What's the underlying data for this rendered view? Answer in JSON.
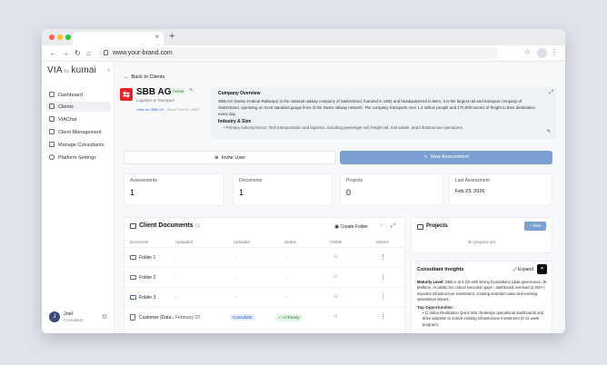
{
  "browser": {
    "url": "www.your-brand.com",
    "tab_close": "×",
    "new_tab": "+"
  },
  "sidebar": {
    "logo_left": "VIA",
    "logo_small": "by",
    "logo_right": "kumai",
    "collapse_icon": "‹",
    "items": [
      {
        "label": "Dashboard"
      },
      {
        "label": "Clients"
      },
      {
        "label": "VIAChat"
      },
      {
        "label": "Client Management"
      },
      {
        "label": "Manage Consultants"
      },
      {
        "label": "Platform Settings"
      }
    ],
    "user": {
      "initial": "J",
      "name": "Joel",
      "role": "Consultant"
    }
  },
  "header": {
    "back_label": "Back to Clients"
  },
  "client": {
    "name": "SBB AG",
    "status": "Active",
    "industry": "Logistics & Transport",
    "website": "View on SBB.CH",
    "since": "Since Feb 02, 2026"
  },
  "overview": {
    "heading": "Company Overview",
    "text": "SBB AG (Swiss Federal Railways) is the national railway company of Switzerland, founded in 1902 and headquartered in Bern. It is the largest rail and transport company of Switzerland, operating on most standard gauge lines of the Swiss railway network. The company transports over 1.4 million people and 170,000 tonnes of freight to their destination every day.",
    "sub_heading": "Industry & Size",
    "bullet": "Primary industry/sector: Rail transportation and logistics, including passenger rail, freight rail, real estate, and infrastructure operations."
  },
  "actions": {
    "invite": "Invite User",
    "new_assessment": "New Assessment"
  },
  "stats": [
    {
      "label": "Assessments",
      "value": "1"
    },
    {
      "label": "Documents",
      "value": "1"
    },
    {
      "label": "Projects",
      "value": "0"
    },
    {
      "label": "Last Assessment",
      "value": "Feb 23, 2026"
    }
  ],
  "documents": {
    "title": "Client Documents",
    "count": "(1)",
    "create_folder": "Create Folder",
    "columns": [
      "Document",
      "Uploaded",
      "Uploader",
      "Status",
      "Visible",
      "Actions"
    ],
    "rows": [
      {
        "name": "Folder 1",
        "uploaded": "-",
        "uploader": "-",
        "status": "-"
      },
      {
        "name": "Folder 2",
        "uploaded": "-",
        "uploader": "-",
        "status": "-"
      },
      {
        "name": "Folder 3",
        "uploaded": "-",
        "uploader": "-",
        "status": "-"
      },
      {
        "name": "Customer (Data...",
        "uploaded": "February 23",
        "uploader": "Consultant",
        "status": "AI-Ready"
      }
    ]
  },
  "projects": {
    "title": "Projects",
    "new_label": "+ New",
    "empty": "No projects yet"
  },
  "insights": {
    "title": "Consultant Insights",
    "expand": "Expand",
    "maturity_label": "Maturity Level:",
    "maturity_text": "SBB is at 3.2/5 with strong foundations (data governance, BI platform, AI pilots) but critical execution gaps - dashboard overload (2,000+) impedes infrastructure investment, creating stranded value and existing operational impact.",
    "top_label": "Top Opportunities:",
    "bullet": "1) Value Realization Quick Win: Redesign operational dashboards and drive adoption to unlock existing infrastructure investment (3-12 week program)."
  }
}
